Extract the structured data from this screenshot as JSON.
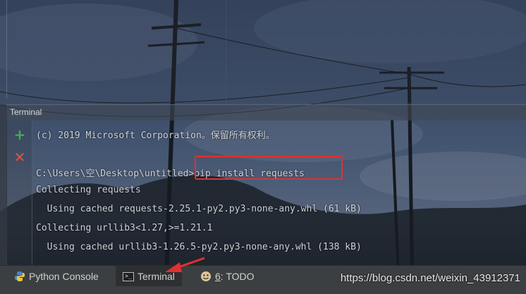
{
  "terminal": {
    "title": "Terminal",
    "lines": [
      "(c) 2019 Microsoft Corporation。保留所有权利。",
      "",
      "C:\\Users\\空\\Desktop\\untitled>pip install requests",
      "Collecting requests",
      "  Using cached requests-2.25.1-py2.py3-none-any.whl (61 kB)",
      "Collecting urllib3<1.27,>=1.21.1",
      "  Using cached urllib3-1.26.5-py2.py3-none-any.whl (138 kB)"
    ],
    "toolbar": {
      "add_icon": "plus-icon",
      "close_icon": "close-icon",
      "add_glyph": "+",
      "close_glyph": "✕"
    }
  },
  "bottom_tabs": {
    "python_console": "Python Console",
    "terminal": "Terminal",
    "todo_num": "6",
    "todo_label": ": TODO"
  },
  "watermark": "https://blog.csdn.net/weixin_43912371",
  "colors": {
    "highlight": "#e0312f",
    "add": "#3fae4f",
    "close": "#e0524a",
    "panel": "#3c3f41"
  }
}
